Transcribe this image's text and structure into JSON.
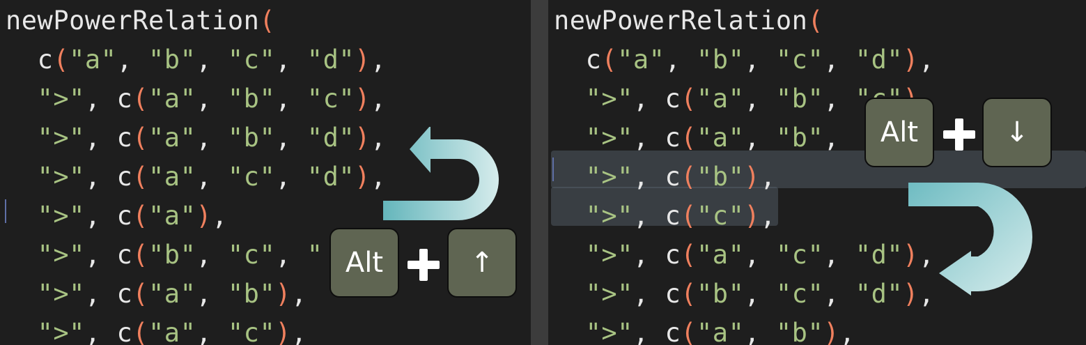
{
  "panes": {
    "left": {
      "lines": [
        {
          "indent": "",
          "tokens": [
            {
              "t": "newPowerRelation",
              "k": "fn"
            },
            {
              "t": "(",
              "k": "paren"
            }
          ]
        },
        {
          "indent": "  ",
          "tokens": [
            {
              "t": "c",
              "k": "fn"
            },
            {
              "t": "(",
              "k": "paren"
            },
            {
              "t": "\"a\"",
              "k": "str"
            },
            {
              "t": ", ",
              "k": "punc"
            },
            {
              "t": "\"b\"",
              "k": "str"
            },
            {
              "t": ", ",
              "k": "punc"
            },
            {
              "t": "\"c\"",
              "k": "str"
            },
            {
              "t": ", ",
              "k": "punc"
            },
            {
              "t": "\"d\"",
              "k": "str"
            },
            {
              "t": ")",
              "k": "paren"
            },
            {
              "t": ",",
              "k": "punc"
            }
          ]
        },
        {
          "indent": "  ",
          "tokens": [
            {
              "t": "\">\"",
              "k": "str"
            },
            {
              "t": ", ",
              "k": "punc"
            },
            {
              "t": "c",
              "k": "fn"
            },
            {
              "t": "(",
              "k": "paren"
            },
            {
              "t": "\"a\"",
              "k": "str"
            },
            {
              "t": ", ",
              "k": "punc"
            },
            {
              "t": "\"b\"",
              "k": "str"
            },
            {
              "t": ", ",
              "k": "punc"
            },
            {
              "t": "\"c\"",
              "k": "str"
            },
            {
              "t": ")",
              "k": "paren"
            },
            {
              "t": ",",
              "k": "punc"
            }
          ]
        },
        {
          "indent": "  ",
          "tokens": [
            {
              "t": "\">\"",
              "k": "str"
            },
            {
              "t": ", ",
              "k": "punc"
            },
            {
              "t": "c",
              "k": "fn"
            },
            {
              "t": "(",
              "k": "paren"
            },
            {
              "t": "\"a\"",
              "k": "str"
            },
            {
              "t": ", ",
              "k": "punc"
            },
            {
              "t": "\"b\"",
              "k": "str"
            },
            {
              "t": ", ",
              "k": "punc"
            },
            {
              "t": "\"d\"",
              "k": "str"
            },
            {
              "t": ")",
              "k": "paren"
            },
            {
              "t": ",",
              "k": "punc"
            }
          ]
        },
        {
          "indent": "  ",
          "tokens": [
            {
              "t": "\">\"",
              "k": "str"
            },
            {
              "t": ", ",
              "k": "punc"
            },
            {
              "t": "c",
              "k": "fn"
            },
            {
              "t": "(",
              "k": "paren"
            },
            {
              "t": "\"a\"",
              "k": "str"
            },
            {
              "t": ", ",
              "k": "punc"
            },
            {
              "t": "\"c\"",
              "k": "str"
            },
            {
              "t": ", ",
              "k": "punc"
            },
            {
              "t": "\"d\"",
              "k": "str"
            },
            {
              "t": ")",
              "k": "paren"
            },
            {
              "t": ",",
              "k": "punc"
            }
          ]
        },
        {
          "indent": "  ",
          "tokens": [
            {
              "t": "\">\"",
              "k": "str"
            },
            {
              "t": ", ",
              "k": "punc"
            },
            {
              "t": "c",
              "k": "fn"
            },
            {
              "t": "(",
              "k": "paren"
            },
            {
              "t": "\"a\"",
              "k": "str"
            },
            {
              "t": ")",
              "k": "paren"
            },
            {
              "t": ",",
              "k": "punc"
            }
          ]
        },
        {
          "indent": "  ",
          "tokens": [
            {
              "t": "\">\"",
              "k": "str"
            },
            {
              "t": ", ",
              "k": "punc"
            },
            {
              "t": "c",
              "k": "fn"
            },
            {
              "t": "(",
              "k": "paren"
            },
            {
              "t": "\"b\"",
              "k": "str"
            },
            {
              "t": ", ",
              "k": "punc"
            },
            {
              "t": "\"c\"",
              "k": "str"
            },
            {
              "t": ", ",
              "k": "punc"
            },
            {
              "t": "\"",
              "k": "str"
            }
          ]
        },
        {
          "indent": "  ",
          "tokens": [
            {
              "t": "\">\"",
              "k": "str"
            },
            {
              "t": ", ",
              "k": "punc"
            },
            {
              "t": "c",
              "k": "fn"
            },
            {
              "t": "(",
              "k": "paren"
            },
            {
              "t": "\"a\"",
              "k": "str"
            },
            {
              "t": ", ",
              "k": "punc"
            },
            {
              "t": "\"b\"",
              "k": "str"
            },
            {
              "t": ")",
              "k": "paren"
            },
            {
              "t": ",",
              "k": "punc"
            }
          ]
        },
        {
          "indent": "  ",
          "tokens": [
            {
              "t": "\">\"",
              "k": "str"
            },
            {
              "t": ", ",
              "k": "punc"
            },
            {
              "t": "c",
              "k": "fn"
            },
            {
              "t": "(",
              "k": "paren"
            },
            {
              "t": "\"a\"",
              "k": "str"
            },
            {
              "t": ", ",
              "k": "punc"
            },
            {
              "t": "\"c\"",
              "k": "str"
            },
            {
              "t": ")",
              "k": "paren"
            },
            {
              "t": ",",
              "k": "punc"
            }
          ]
        }
      ]
    },
    "right": {
      "lines": [
        {
          "indent": "",
          "tokens": [
            {
              "t": "newPowerRelation",
              "k": "fn"
            },
            {
              "t": "(",
              "k": "paren"
            }
          ]
        },
        {
          "indent": "  ",
          "tokens": [
            {
              "t": "c",
              "k": "fn"
            },
            {
              "t": "(",
              "k": "paren"
            },
            {
              "t": "\"a\"",
              "k": "str"
            },
            {
              "t": ", ",
              "k": "punc"
            },
            {
              "t": "\"b\"",
              "k": "str"
            },
            {
              "t": ", ",
              "k": "punc"
            },
            {
              "t": "\"c\"",
              "k": "str"
            },
            {
              "t": ", ",
              "k": "punc"
            },
            {
              "t": "\"d\"",
              "k": "str"
            },
            {
              "t": ")",
              "k": "paren"
            },
            {
              "t": ",",
              "k": "punc"
            }
          ]
        },
        {
          "indent": "  ",
          "tokens": [
            {
              "t": "\">\"",
              "k": "str"
            },
            {
              "t": ", ",
              "k": "punc"
            },
            {
              "t": "c",
              "k": "fn"
            },
            {
              "t": "(",
              "k": "paren"
            },
            {
              "t": "\"a\"",
              "k": "str"
            },
            {
              "t": ", ",
              "k": "punc"
            },
            {
              "t": "\"b\"",
              "k": "str"
            },
            {
              "t": ", ",
              "k": "punc"
            },
            {
              "t": "\"c\"",
              "k": "str"
            },
            {
              "t": ")",
              "k": "paren"
            }
          ]
        },
        {
          "indent": "  ",
          "tokens": [
            {
              "t": "\">\"",
              "k": "str"
            },
            {
              "t": ", ",
              "k": "punc"
            },
            {
              "t": "c",
              "k": "fn"
            },
            {
              "t": "(",
              "k": "paren"
            },
            {
              "t": "\"a\"",
              "k": "str"
            },
            {
              "t": ", ",
              "k": "punc"
            },
            {
              "t": "\"b\"",
              "k": "str"
            },
            {
              "t": ",",
              "k": "punc"
            }
          ]
        },
        {
          "indent": "  ",
          "tokens": [
            {
              "t": "\">\"",
              "k": "str"
            },
            {
              "t": ", ",
              "k": "punc"
            },
            {
              "t": "c",
              "k": "fn"
            },
            {
              "t": "(",
              "k": "paren"
            },
            {
              "t": "\"b\"",
              "k": "str"
            },
            {
              "t": ")",
              "k": "paren"
            },
            {
              "t": ",",
              "k": "punc"
            }
          ]
        },
        {
          "indent": "  ",
          "tokens": [
            {
              "t": "\">\"",
              "k": "str"
            },
            {
              "t": ", ",
              "k": "punc"
            },
            {
              "t": "c",
              "k": "fn"
            },
            {
              "t": "(",
              "k": "paren"
            },
            {
              "t": "\"c\"",
              "k": "str"
            },
            {
              "t": ")",
              "k": "paren"
            },
            {
              "t": ",",
              "k": "punc"
            }
          ]
        },
        {
          "indent": "  ",
          "tokens": [
            {
              "t": "\">\"",
              "k": "str"
            },
            {
              "t": ", ",
              "k": "punc"
            },
            {
              "t": "c",
              "k": "fn"
            },
            {
              "t": "(",
              "k": "paren"
            },
            {
              "t": "\"a\"",
              "k": "str"
            },
            {
              "t": ", ",
              "k": "punc"
            },
            {
              "t": "\"c\"",
              "k": "str"
            },
            {
              "t": ", ",
              "k": "punc"
            },
            {
              "t": "\"d\"",
              "k": "str"
            },
            {
              "t": ")",
              "k": "paren"
            },
            {
              "t": ",",
              "k": "punc"
            }
          ]
        },
        {
          "indent": "  ",
          "tokens": [
            {
              "t": "\">\"",
              "k": "str"
            },
            {
              "t": ", ",
              "k": "punc"
            },
            {
              "t": "c",
              "k": "fn"
            },
            {
              "t": "(",
              "k": "paren"
            },
            {
              "t": "\"b\"",
              "k": "str"
            },
            {
              "t": ", ",
              "k": "punc"
            },
            {
              "t": "\"c\"",
              "k": "str"
            },
            {
              "t": ", ",
              "k": "punc"
            },
            {
              "t": "\"d\"",
              "k": "str"
            },
            {
              "t": ")",
              "k": "paren"
            },
            {
              "t": ",",
              "k": "punc"
            }
          ]
        },
        {
          "indent": "  ",
          "tokens": [
            {
              "t": "\">\"",
              "k": "str"
            },
            {
              "t": ", ",
              "k": "punc"
            },
            {
              "t": "c",
              "k": "fn"
            },
            {
              "t": "(",
              "k": "paren"
            },
            {
              "t": "\"a\"",
              "k": "str"
            },
            {
              "t": ", ",
              "k": "punc"
            },
            {
              "t": "\"b\"",
              "k": "str"
            },
            {
              "t": ")",
              "k": "paren"
            },
            {
              "t": ",",
              "k": "punc"
            }
          ]
        }
      ]
    }
  },
  "shortcuts": {
    "up": {
      "modifier": "Alt",
      "key": "↑"
    },
    "down": {
      "modifier": "Alt",
      "key": "↓"
    }
  },
  "icons": {
    "move_up_arrow": "curved-arrow-up-icon",
    "move_down_arrow": "curved-arrow-down-icon",
    "plus": "plus-icon"
  },
  "colors": {
    "background": "#1e1e1e",
    "divider": "#3c3c3c",
    "text": "#e8e8e8",
    "string": "#a8c383",
    "paren": "#f0805e",
    "selection": "#4a525a",
    "key_fill": "#5f6552",
    "arrow": "#8fc8cc"
  }
}
